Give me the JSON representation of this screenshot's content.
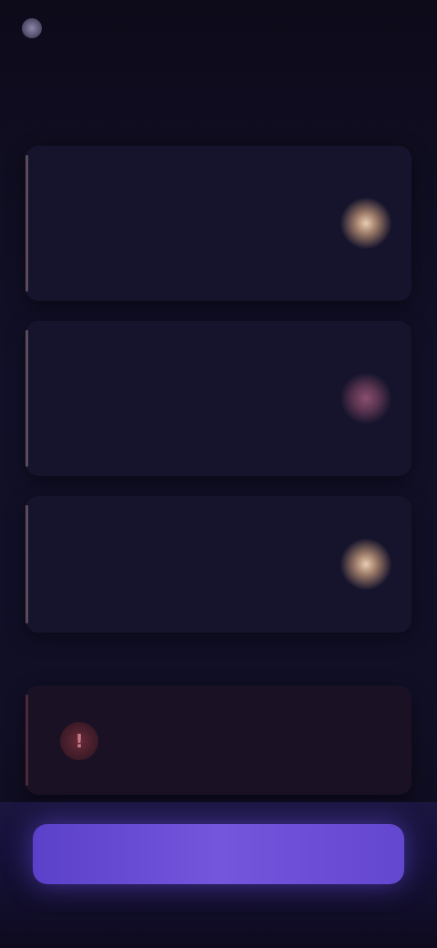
{
  "header": {
    "brand": "",
    "action_label": ""
  },
  "cards": [
    {
      "title": "",
      "subtitle": "",
      "meta": "",
      "status_icon": "warm-glow-dot"
    },
    {
      "title": "",
      "subtitle": "",
      "meta": "",
      "status_icon": "rose-glow-dot"
    },
    {
      "title": "",
      "subtitle": "",
      "meta": "",
      "status_icon": "warm-glow-dot"
    }
  ],
  "alert": {
    "icon": "alert-icon",
    "icon_glyph": "!",
    "title": "",
    "text": "",
    "sub": ""
  },
  "cta": {
    "label": ""
  },
  "colors": {
    "background": "#0c0a18",
    "card": "#16142c",
    "accent": "#6a4fd6",
    "warm": "#e8cdb2",
    "rose": "#8a5070",
    "alert": "#6a2a3a"
  }
}
